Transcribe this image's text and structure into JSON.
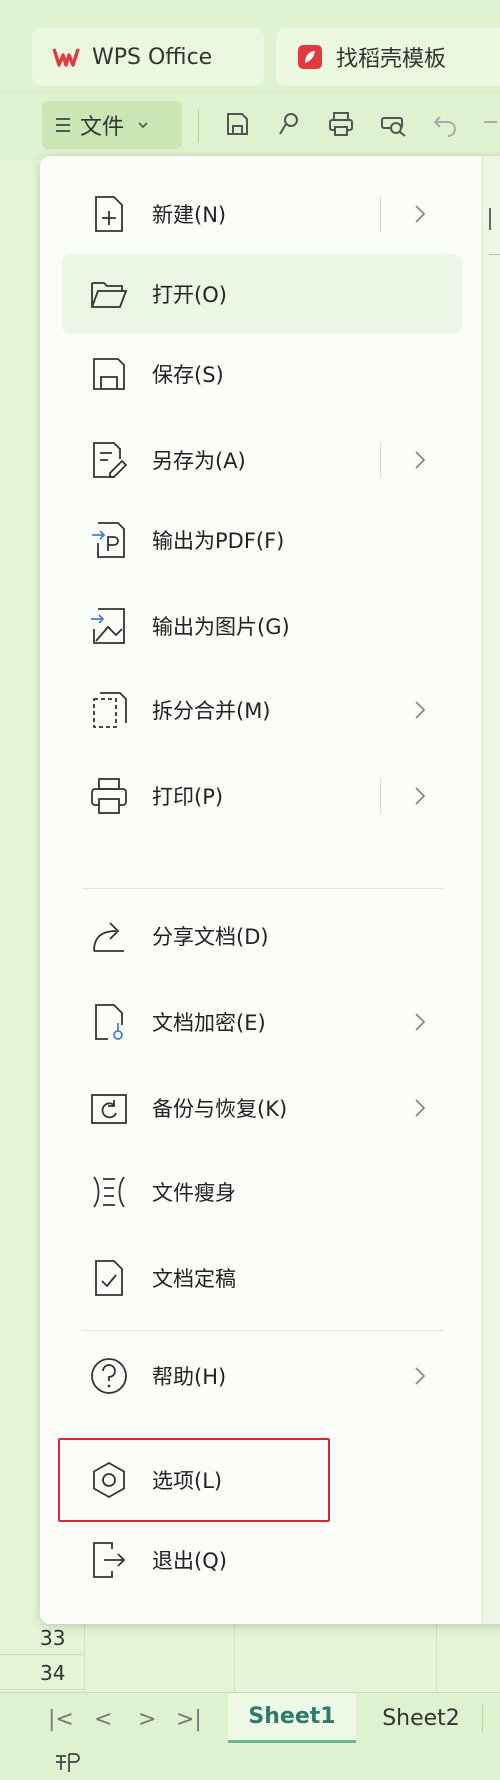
{
  "tabs": {
    "wps": {
      "label": "WPS Office",
      "logo_color": "#e0393e"
    },
    "template": {
      "label": "找稻壳模板",
      "logo_color": "#e0393e"
    }
  },
  "toolbar": {
    "file_label": "文件",
    "icons": [
      "save-icon",
      "format-painter-icon",
      "print-icon",
      "print-preview-icon",
      "undo-icon",
      "redo-icon"
    ]
  },
  "menu": {
    "items": [
      {
        "label": "新建(N)",
        "icon": "new-icon",
        "submenu": true
      },
      {
        "label": "打开(O)",
        "icon": "open-folder-icon",
        "submenu": false,
        "hover": true
      },
      {
        "label": "保存(S)",
        "icon": "save-icon",
        "submenu": false
      },
      {
        "label": "另存为(A)",
        "icon": "save-as-icon",
        "submenu": true
      },
      {
        "label": "输出为PDF(F)",
        "icon": "export-pdf-icon",
        "submenu": false
      },
      {
        "label": "输出为图片(G)",
        "icon": "export-image-icon",
        "submenu": false
      },
      {
        "label": "拆分合并(M)",
        "icon": "split-merge-icon",
        "submenu": true
      },
      {
        "label": "打印(P)",
        "icon": "print-icon",
        "submenu": true
      },
      {
        "label": "分享文档(D)",
        "icon": "share-icon",
        "submenu": false
      },
      {
        "label": "文档加密(E)",
        "icon": "encrypt-icon",
        "submenu": true
      },
      {
        "label": "备份与恢复(K)",
        "icon": "backup-icon",
        "submenu": true
      },
      {
        "label": "文件瘦身",
        "icon": "slim-icon",
        "submenu": false
      },
      {
        "label": "文档定稿",
        "icon": "finalize-icon",
        "submenu": false
      },
      {
        "label": "帮助(H)",
        "icon": "help-icon",
        "submenu": true
      },
      {
        "label": "选项(L)",
        "icon": "options-icon",
        "submenu": false,
        "highlighted": true
      },
      {
        "label": "退出(Q)",
        "icon": "exit-icon",
        "submenu": false
      }
    ]
  },
  "grid": {
    "row_numbers": [
      "33",
      "34"
    ]
  },
  "sheet_tabs": {
    "active": "Sheet1",
    "inactive": "Sheet2",
    "nav": [
      "|<",
      "<",
      ">",
      ">|"
    ]
  },
  "colors": {
    "accent": "#2f7a6a",
    "highlight_border": "#d12b36",
    "background": "#dff2cf"
  }
}
